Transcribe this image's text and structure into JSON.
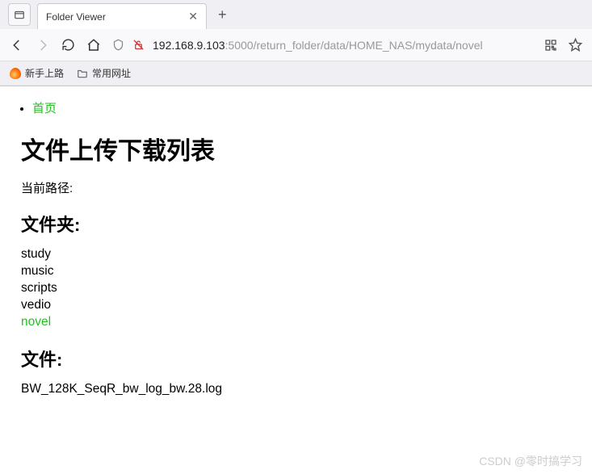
{
  "browser": {
    "tab_title": "Folder Viewer",
    "url_prefix": "192.168.9.103",
    "url_rest": ":5000/return_folder/data/HOME_NAS/mydata/novel"
  },
  "bookmarks": {
    "item1": "新手上路",
    "item2": "常用网址"
  },
  "nav": {
    "home": "首页"
  },
  "page": {
    "title": "文件上传下载列表",
    "current_path_label": "当前路径:",
    "folders_heading": "文件夹:",
    "files_heading": "文件:"
  },
  "folders": {
    "items": [
      {
        "name": "study",
        "active": false
      },
      {
        "name": "music",
        "active": false
      },
      {
        "name": "scripts",
        "active": false
      },
      {
        "name": "vedio",
        "active": false
      },
      {
        "name": "novel",
        "active": true
      }
    ]
  },
  "files": {
    "items": [
      {
        "name": "BW_128K_SeqR_bw_log_bw.28.log"
      }
    ]
  },
  "watermark": "CSDN @零时搞学习"
}
